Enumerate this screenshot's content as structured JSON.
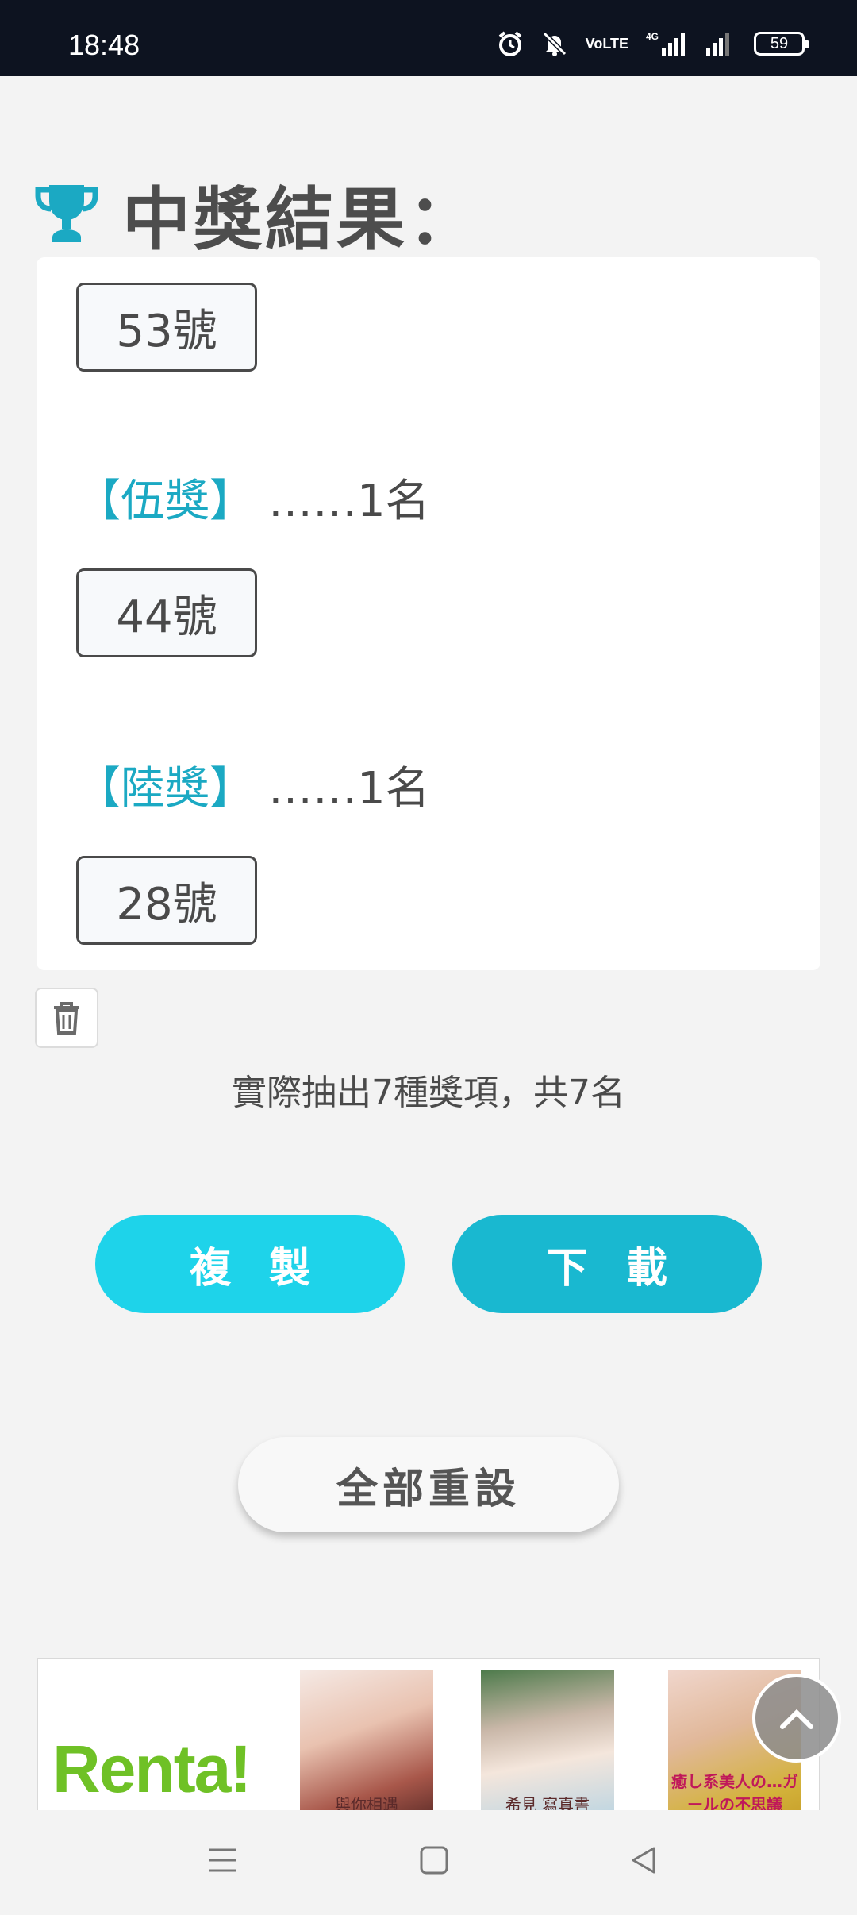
{
  "status_bar": {
    "time": "18:48",
    "network_labels": [
      "VoLTE",
      "4G"
    ],
    "battery": "59"
  },
  "results": {
    "title": "中獎結果：",
    "icon": "trophy-icon",
    "accent_color": "#1ba9c3",
    "first_number": "53號",
    "prizes": [
      {
        "name": "【伍獎】",
        "count": "……1名",
        "number": "44號"
      },
      {
        "name": "【陸獎】",
        "count": "……1名",
        "number": "28號"
      }
    ]
  },
  "summary": "實際抽出7種獎項，共7名",
  "actions": {
    "copy_label": "複製",
    "download_label": "下載",
    "reset_label": "全部重設",
    "copy_color": "#1ed3ea",
    "download_color": "#19b8d0"
  },
  "ad": {
    "logo": "Renta!",
    "covers": [
      "與你相遇",
      "希見 寫真書",
      "癒し系美人の…ガールの不思議"
    ]
  },
  "nav": {
    "icons": [
      "menu-icon",
      "home-icon",
      "back-icon"
    ]
  }
}
